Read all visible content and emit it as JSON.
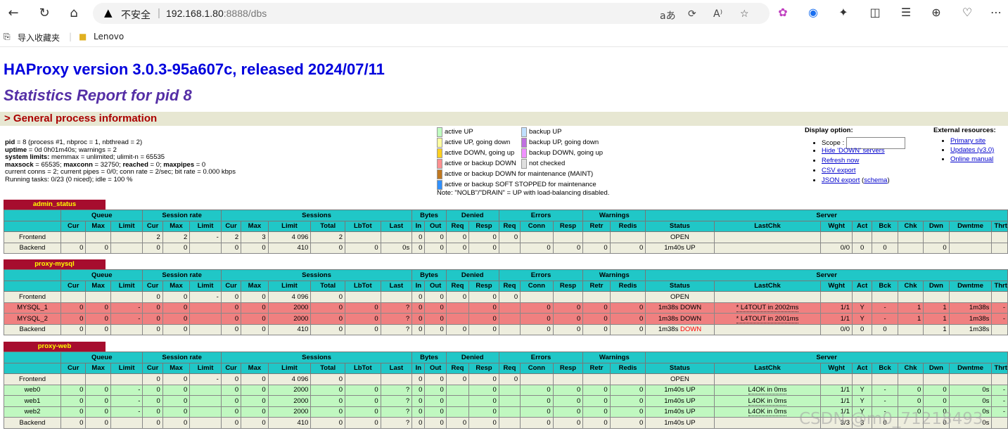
{
  "browser": {
    "security_label": "不安全",
    "url_host": "192.168.1.80",
    "url_rest": ":8888/dbs",
    "bookmarks": [
      {
        "label": "导入收藏夹"
      },
      {
        "label": "Lenovo"
      }
    ],
    "toolbar_text": {
      "translate": "aあ",
      "read": "A⁾"
    }
  },
  "page": {
    "title": "HAProxy version 3.0.3-95a607c, released 2024/07/11",
    "subtitle": "Statistics Report for pid 8",
    "section": "> General process information"
  },
  "process_info": [
    {
      "b": "pid",
      "t": " = 8 (process #1, nbproc = 1, nbthread = 2)"
    },
    {
      "b": "uptime",
      "t": " = 0d 0h01m40s; warnings = 2"
    },
    {
      "b": "system limits:",
      "t": " memmax = unlimited; ulimit-n = 65535"
    },
    {
      "b": "maxsock",
      "t": " = 65535; ",
      "b2": "maxconn",
      "t2": " = 32750; ",
      "b3": "reached",
      "t3": " = 0; ",
      "b4": "maxpipes",
      "t4": " = 0"
    },
    {
      "t": "current conns = 2; current pipes = 0/0; conn rate = 2/sec; bit rate = 0.000 kbps"
    },
    {
      "t": "Running tasks: 0/23 (0 niced); idle = 100 %"
    }
  ],
  "legend": {
    "left": [
      {
        "label": "active UP",
        "color": "#c0ffc0"
      },
      {
        "label": "active UP, going down",
        "color": "#ffffa0"
      },
      {
        "label": "active DOWN, going up",
        "color": "#ffd020"
      },
      {
        "label": "active or backup DOWN",
        "color": "#ff9090"
      },
      {
        "label": "active or backup DOWN for maintenance (MAINT)",
        "color": "#c07820"
      },
      {
        "label": "active or backup SOFT STOPPED for maintenance",
        "color": "#3090ff"
      }
    ],
    "right": [
      {
        "label": "backup UP",
        "color": "#c0e0ff"
      },
      {
        "label": "backup UP, going down",
        "color": "#c070e0"
      },
      {
        "label": "backup DOWN, going up",
        "color": "#f090ff"
      },
      {
        "label": "not checked",
        "color": "#e0e0e0"
      }
    ],
    "note": "Note: \"NOLB\"/\"DRAIN\" = UP with load-balancing disabled."
  },
  "display_options": {
    "heading": "Display option:",
    "scope_label": "Scope :",
    "links": [
      "Hide 'DOWN' servers",
      "Refresh now",
      "CSV export"
    ],
    "json_export": "JSON export",
    "schema_open": " (",
    "schema": "schema",
    "schema_close": ")"
  },
  "external_resources": {
    "heading": "External resources:",
    "links": [
      "Primary site",
      "Updates (v3.0)",
      "Online manual"
    ]
  },
  "header_groups": [
    "",
    "Queue",
    "Session rate",
    "Sessions",
    "Bytes",
    "Denied",
    "Errors",
    "Warnings",
    "Server"
  ],
  "columns": [
    "",
    "Cur",
    "Max",
    "Limit",
    "Cur",
    "Max",
    "Limit",
    "Cur",
    "Max",
    "Limit",
    "Total",
    "LbTot",
    "Last",
    "In",
    "Out",
    "Req",
    "Resp",
    "Req",
    "Conn",
    "Resp",
    "Retr",
    "Redis",
    "Status",
    "LastChk",
    "Wght",
    "Act",
    "Bck",
    "Chk",
    "Dwn",
    "Dwntme",
    "Thrtle"
  ],
  "proxies": [
    {
      "name": "admin_status",
      "rows": [
        {
          "kind": "fe",
          "cells": [
            "Frontend",
            "",
            "",
            "",
            "2",
            "2",
            "-",
            "2",
            "3",
            "4 096",
            "2",
            "",
            "",
            "0",
            "0",
            "0",
            "0",
            "0",
            "",
            "",
            "",
            "",
            "OPEN",
            "",
            "",
            "",
            "",
            "",
            "",
            "",
            ""
          ]
        },
        {
          "kind": "be",
          "cells": [
            "Backend",
            "0",
            "0",
            "",
            "0",
            "0",
            "",
            "0",
            "0",
            "410",
            "0",
            "0",
            "0s",
            "0",
            "0",
            "0",
            "0",
            "",
            "0",
            "0",
            "0",
            "0",
            "1m40s UP",
            "",
            "0/0",
            "0",
            "0",
            "",
            "0",
            "",
            ""
          ]
        }
      ]
    },
    {
      "name": "proxy-mysql",
      "rows": [
        {
          "kind": "fe",
          "cells": [
            "Frontend",
            "",
            "",
            "",
            "0",
            "0",
            "-",
            "0",
            "0",
            "4 096",
            "0",
            "",
            "",
            "0",
            "0",
            "0",
            "0",
            "0",
            "",
            "",
            "",
            "",
            "OPEN",
            "",
            "",
            "",
            "",
            "",
            "",
            "",
            ""
          ]
        },
        {
          "kind": "down",
          "cells": [
            "MYSQL_1",
            "0",
            "0",
            "-",
            "0",
            "0",
            "",
            "0",
            "0",
            "2000",
            "0",
            "0",
            "?",
            "0",
            "0",
            "",
            "0",
            "",
            "0",
            "0",
            "0",
            "0",
            "1m38s DOWN",
            "* L4TOUT in 2002ms",
            "1/1",
            "Y",
            "-",
            "1",
            "1",
            "1m38s",
            "-"
          ]
        },
        {
          "kind": "down",
          "cells": [
            "MYSQL_2",
            "0",
            "0",
            "-",
            "0",
            "0",
            "",
            "0",
            "0",
            "2000",
            "0",
            "0",
            "?",
            "0",
            "0",
            "",
            "0",
            "",
            "0",
            "0",
            "0",
            "0",
            "1m38s DOWN",
            "* L4TOUT in 2001ms",
            "1/1",
            "Y",
            "-",
            "1",
            "1",
            "1m38s",
            "-"
          ]
        },
        {
          "kind": "be",
          "cells": [
            "Backend",
            "0",
            "0",
            "",
            "0",
            "0",
            "",
            "0",
            "0",
            "410",
            "0",
            "0",
            "?",
            "0",
            "0",
            "0",
            "0",
            "",
            "0",
            "0",
            "0",
            "0",
            "1m38s DOWN",
            "",
            "0/0",
            "0",
            "0",
            "",
            "1",
            "1m38s",
            ""
          ]
        }
      ]
    },
    {
      "name": "proxy-web",
      "rows": [
        {
          "kind": "fe",
          "cells": [
            "Frontend",
            "",
            "",
            "",
            "0",
            "0",
            "-",
            "0",
            "0",
            "4 096",
            "0",
            "",
            "",
            "0",
            "0",
            "0",
            "0",
            "0",
            "",
            "",
            "",
            "",
            "OPEN",
            "",
            "",
            "",
            "",
            "",
            "",
            "",
            ""
          ]
        },
        {
          "kind": "up",
          "cells": [
            "web0",
            "0",
            "0",
            "-",
            "0",
            "0",
            "",
            "0",
            "0",
            "2000",
            "0",
            "0",
            "?",
            "0",
            "0",
            "",
            "0",
            "",
            "0",
            "0",
            "0",
            "0",
            "1m40s UP",
            "L4OK in 0ms",
            "1/1",
            "Y",
            "-",
            "0",
            "0",
            "0s",
            "-"
          ]
        },
        {
          "kind": "up",
          "cells": [
            "web1",
            "0",
            "0",
            "-",
            "0",
            "0",
            "",
            "0",
            "0",
            "2000",
            "0",
            "0",
            "?",
            "0",
            "0",
            "",
            "0",
            "",
            "0",
            "0",
            "0",
            "0",
            "1m40s UP",
            "L4OK in 0ms",
            "1/1",
            "Y",
            "-",
            "0",
            "0",
            "0s",
            "-"
          ]
        },
        {
          "kind": "up",
          "cells": [
            "web2",
            "0",
            "0",
            "-",
            "0",
            "0",
            "",
            "0",
            "0",
            "2000",
            "0",
            "0",
            "?",
            "0",
            "0",
            "",
            "0",
            "",
            "0",
            "0",
            "0",
            "0",
            "1m40s UP",
            "L4OK in 0ms",
            "1/1",
            "Y",
            "-",
            "0",
            "0",
            "0s",
            "-"
          ]
        },
        {
          "kind": "be",
          "cells": [
            "Backend",
            "0",
            "0",
            "",
            "0",
            "0",
            "",
            "0",
            "0",
            "410",
            "0",
            "0",
            "?",
            "0",
            "0",
            "0",
            "0",
            "",
            "0",
            "0",
            "0",
            "0",
            "1m40s UP",
            "",
            "3/3",
            "3",
            "0",
            "",
            "0",
            "0s",
            ""
          ]
        }
      ]
    }
  ],
  "watermark": "CSDN @m0_71218493"
}
